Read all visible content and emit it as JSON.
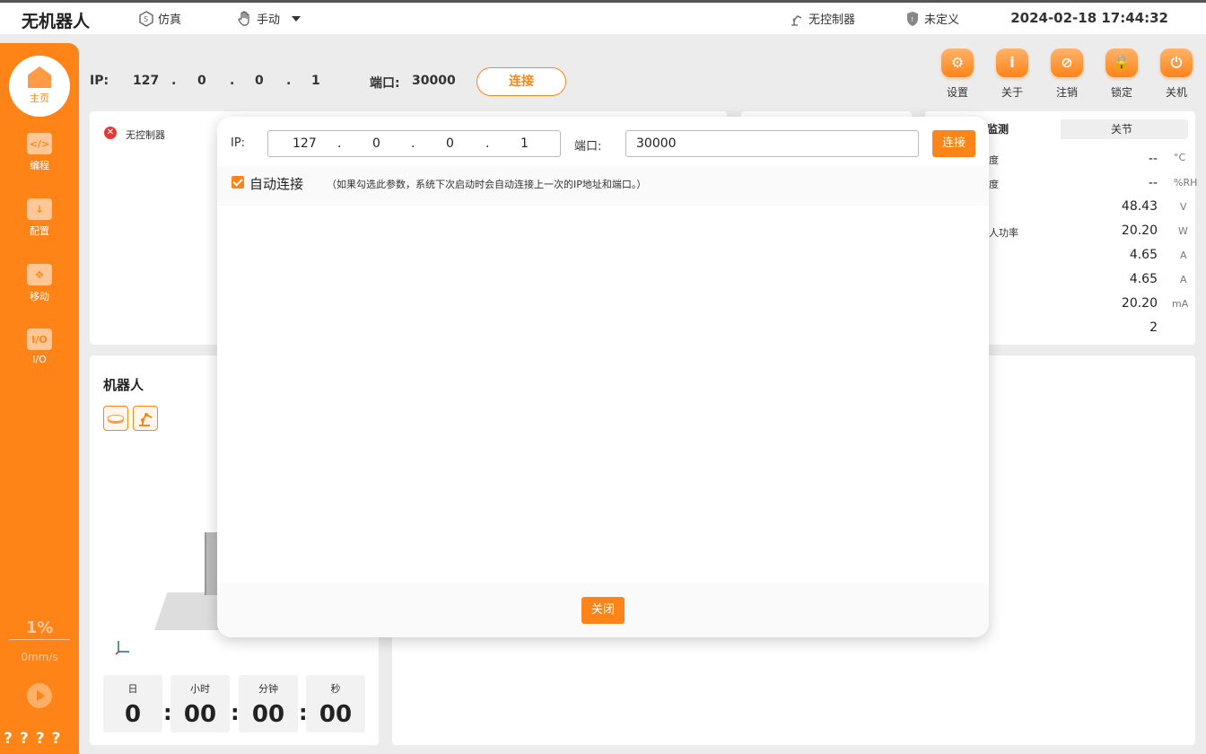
{
  "topbar": {
    "title": "无机器人",
    "mode_sim": "仿真",
    "mode_manual": "手动",
    "controller_status": "无控制器",
    "safety_status": "未定义",
    "datetime": "2024-02-18 17:44:32"
  },
  "sidebar": {
    "home": "主页",
    "items": [
      {
        "label": "编程",
        "icon_text": "</>"
      },
      {
        "label": "配置",
        "icon_text": "↓"
      },
      {
        "label": "移动",
        "icon_text": "✥"
      },
      {
        "label": "I/O",
        "icon_text": "I/O"
      }
    ],
    "speed_percent": "1%",
    "speed_value": "0mm/s",
    "bottom_text": "????"
  },
  "connection": {
    "ip_label": "IP:",
    "ip": [
      "127",
      ".",
      "0",
      ".",
      "0",
      ".",
      "1"
    ],
    "port_label": "端口:",
    "port": "30000",
    "connect_label": "连接"
  },
  "actions": [
    {
      "label": "设置",
      "icon_text": "⚙"
    },
    {
      "label": "关于",
      "icon_text": "i"
    },
    {
      "label": "注销",
      "icon_text": "⊘"
    },
    {
      "label": "锁定",
      "icon_text": "🔒"
    },
    {
      "label": "关机",
      "icon_text": "⏻"
    }
  ],
  "status_panel": {
    "text": "无控制器"
  },
  "monitor": {
    "tab_active": "监测",
    "tab_other": "关节",
    "rows": [
      {
        "label": "度",
        "value": "--",
        "unit": "°C"
      },
      {
        "label": "度",
        "value": "--",
        "unit": "%RH"
      },
      {
        "label": "",
        "value": "48.43",
        "unit": "V"
      },
      {
        "label": "人功率",
        "value": "20.20",
        "unit": "W"
      },
      {
        "label": "",
        "value": "4.65",
        "unit": "A"
      },
      {
        "label": "",
        "value": "4.65",
        "unit": "A"
      },
      {
        "label": "",
        "value": "20.20",
        "unit": "mA"
      },
      {
        "label": "",
        "value": "2",
        "unit": ""
      }
    ]
  },
  "robot_panel": {
    "title": "机器人",
    "timer": [
      {
        "label": "日",
        "value": "0"
      },
      {
        "label": "小时",
        "value": "00"
      },
      {
        "label": "分钟",
        "value": "00"
      },
      {
        "label": "秒",
        "value": "00"
      }
    ],
    "separator": ":"
  },
  "dialog": {
    "ip_label": "IP:",
    "ip": [
      "127",
      ".",
      "0",
      ".",
      "0",
      ".",
      "1"
    ],
    "port_label": "端口:",
    "port": "30000",
    "connect_label": "连接",
    "auto_connect_label": "自动连接",
    "auto_connect_checked": true,
    "auto_connect_hint": "（如果勾选此参数，系统下次启动时会自动连接上一次的IP地址和端口。）",
    "close_label": "关闭"
  },
  "colors": {
    "accent": "#ff8418",
    "error": "#e53935"
  }
}
